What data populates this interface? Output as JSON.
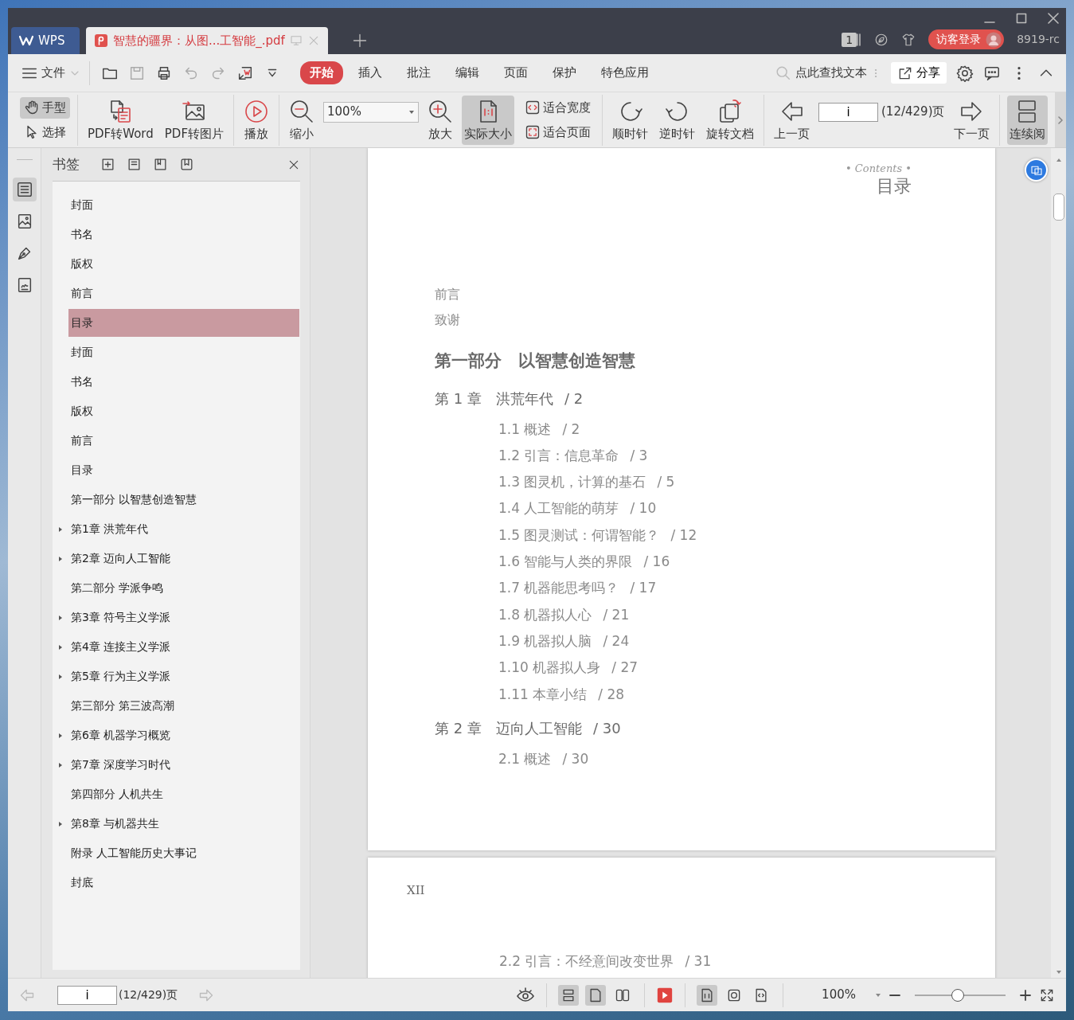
{
  "tabs": [
    {
      "label": "WPS",
      "kind": "home",
      "selected": false
    },
    {
      "label": "智慧的疆界：从图...工智能_.pdf",
      "kind": "document",
      "selected": true
    }
  ],
  "title_bar": {
    "window_count": "1",
    "login": "访客登录",
    "user": "8919-rc"
  },
  "menu": {
    "file": "文件",
    "ribbon_tabs": [
      {
        "label": "开始",
        "selected": true
      },
      {
        "label": "插入",
        "selected": false
      },
      {
        "label": "批注",
        "selected": false
      },
      {
        "label": "编辑",
        "selected": false
      },
      {
        "label": "页面",
        "selected": false
      },
      {
        "label": "保护",
        "selected": false
      },
      {
        "label": "特色应用",
        "selected": false
      }
    ],
    "search_placeholder": "点此查找文本",
    "share": "分享"
  },
  "toolbar_groups": [
    [
      {
        "kind": "pair",
        "items": [
          {
            "label": "手型",
            "selected": true
          },
          {
            "label": "选择",
            "selected": false
          }
        ]
      }
    ],
    [
      {
        "kind": "big",
        "label": "PDF转Word"
      },
      {
        "kind": "big",
        "label": "PDF转图片"
      }
    ],
    [
      {
        "kind": "big",
        "label": "播放"
      }
    ],
    [
      {
        "kind": "big",
        "label": "缩小"
      },
      {
        "kind": "zoom_field",
        "value": "100%"
      },
      {
        "kind": "big",
        "label": "放大"
      },
      {
        "kind": "big",
        "label": "实际大小",
        "selected": true
      },
      {
        "kind": "pair",
        "items": [
          {
            "label": "适合宽度",
            "selected": false
          },
          {
            "label": "适合页面",
            "selected": false
          }
        ]
      }
    ],
    [
      {
        "kind": "big",
        "label": "顺时针"
      },
      {
        "kind": "big",
        "label": "逆时针"
      },
      {
        "kind": "big",
        "label": "旋转文档"
      }
    ],
    [
      {
        "kind": "big",
        "label": "上一页"
      },
      {
        "kind": "page_field",
        "value": "i",
        "total": "(12/429)页"
      },
      {
        "kind": "big",
        "label": "下一页"
      }
    ],
    [
      {
        "kind": "big",
        "label": "连续阅",
        "selected": true
      }
    ]
  ],
  "rail": [
    {
      "selected": true
    },
    {
      "selected": false
    },
    {
      "selected": false
    },
    {
      "selected": false
    }
  ],
  "bookmarks": {
    "title": "书签",
    "items": [
      {
        "label": "封面",
        "expandable": false,
        "selected": false
      },
      {
        "label": "书名",
        "expandable": false,
        "selected": false
      },
      {
        "label": "版权",
        "expandable": false,
        "selected": false
      },
      {
        "label": "前言",
        "expandable": false,
        "selected": false
      },
      {
        "label": "目录",
        "expandable": false,
        "selected": true
      },
      {
        "label": "封面",
        "expandable": false,
        "selected": false
      },
      {
        "label": "书名",
        "expandable": false,
        "selected": false
      },
      {
        "label": "版权",
        "expandable": false,
        "selected": false
      },
      {
        "label": "前言",
        "expandable": false,
        "selected": false
      },
      {
        "label": "目录",
        "expandable": false,
        "selected": false
      },
      {
        "label": "第一部分 以智慧创造智慧",
        "expandable": false,
        "selected": false
      },
      {
        "label": "第1章 洪荒年代",
        "expandable": true,
        "selected": false
      },
      {
        "label": "第2章 迈向人工智能",
        "expandable": true,
        "selected": false
      },
      {
        "label": "第二部分 学派争鸣",
        "expandable": false,
        "selected": false
      },
      {
        "label": "第3章 符号主义学派",
        "expandable": true,
        "selected": false
      },
      {
        "label": "第4章 连接主义学派",
        "expandable": true,
        "selected": false
      },
      {
        "label": "第5章 行为主义学派",
        "expandable": true,
        "selected": false
      },
      {
        "label": "第三部分 第三波高潮",
        "expandable": false,
        "selected": false
      },
      {
        "label": "第6章 机器学习概览",
        "expandable": true,
        "selected": false
      },
      {
        "label": "第7章 深度学习时代",
        "expandable": true,
        "selected": false
      },
      {
        "label": "第四部分 人机共生",
        "expandable": false,
        "selected": false
      },
      {
        "label": "第8章 与机器共生",
        "expandable": true,
        "selected": false
      },
      {
        "label": "附录 人工智能历史大事记",
        "expandable": false,
        "selected": false
      },
      {
        "label": "封底",
        "expandable": false,
        "selected": false
      }
    ]
  },
  "pages": [
    {
      "header_script": "• Contents •",
      "heading": "目录",
      "entries": [
        {
          "kind": "plain",
          "title": "前言"
        },
        {
          "kind": "plain",
          "title": "致谢"
        },
        {
          "kind": "part",
          "title": "第一部分　以智慧创造智慧"
        },
        {
          "kind": "chapter",
          "title": "第 1 章　洪荒年代",
          "page": "/ 2"
        },
        {
          "kind": "section",
          "title": "1.1 概述",
          "page": "/ 2"
        },
        {
          "kind": "section",
          "title": "1.2 引言：信息革命",
          "page": "/ 3"
        },
        {
          "kind": "section",
          "title": "1.3 图灵机，计算的基石",
          "page": "/ 5"
        },
        {
          "kind": "section",
          "title": "1.4 人工智能的萌芽",
          "page": "/ 10"
        },
        {
          "kind": "section",
          "title": "1.5 图灵测试：何谓智能？",
          "page": "/ 12"
        },
        {
          "kind": "section",
          "title": "1.6 智能与人类的界限",
          "page": "/ 16"
        },
        {
          "kind": "section",
          "title": "1.7 机器能思考吗？",
          "page": "/ 17"
        },
        {
          "kind": "section",
          "title": "1.8 机器拟人心",
          "page": "/ 21"
        },
        {
          "kind": "section",
          "title": "1.9 机器拟人脑",
          "page": "/ 24"
        },
        {
          "kind": "section",
          "title": "1.10 机器拟人身",
          "page": "/ 27"
        },
        {
          "kind": "section",
          "title": "1.11 本章小结",
          "page": "/ 28"
        },
        {
          "kind": "chapter",
          "title": "第 2 章　迈向人工智能",
          "page": "/ 30"
        },
        {
          "kind": "section",
          "title": "2.1 概述",
          "page": "/ 30"
        }
      ]
    },
    {
      "page_number": "XII",
      "entries": [
        {
          "kind": "section",
          "title": "2.2 引言：不经意间改变世界",
          "page": "/ 31"
        }
      ]
    }
  ],
  "status_bar": {
    "page_input": "i",
    "page_total": "(12/429)页",
    "view_modes": [
      {
        "selected": true
      },
      {
        "selected": true
      },
      {
        "selected": false
      }
    ],
    "fit_modes": [
      {
        "selected": true
      },
      {
        "selected": false
      },
      {
        "selected": false
      }
    ],
    "zoom": "100%",
    "zoom_slider": {
      "level": 0.47
    }
  }
}
